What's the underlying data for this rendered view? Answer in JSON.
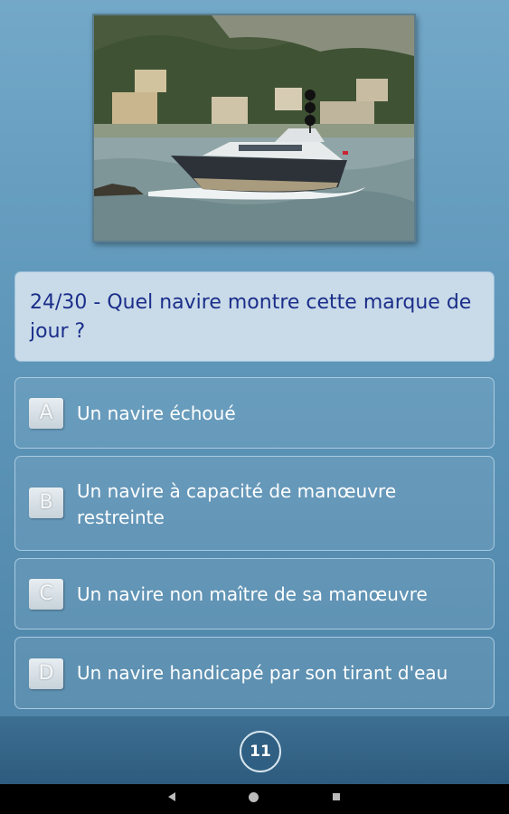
{
  "question": {
    "text": "24/30 - Quel navire montre cette marque de jour ?"
  },
  "answers": [
    {
      "letter": "A",
      "text": "Un navire échoué"
    },
    {
      "letter": "B",
      "text": "Un navire à capacité de manœuvre restreinte"
    },
    {
      "letter": "C",
      "text": "Un navire non maître de sa manœuvre"
    },
    {
      "letter": "D",
      "text": "Un navire handicapé par son tirant d'eau"
    }
  ],
  "footer": {
    "counter": "11"
  },
  "navbar": {
    "icons": [
      "back-icon",
      "home-icon",
      "recent-apps-icon"
    ]
  },
  "colors": {
    "question_text": "#1b2e8a",
    "background_top": "#73a8c8",
    "background_bottom": "#4f86aa"
  }
}
